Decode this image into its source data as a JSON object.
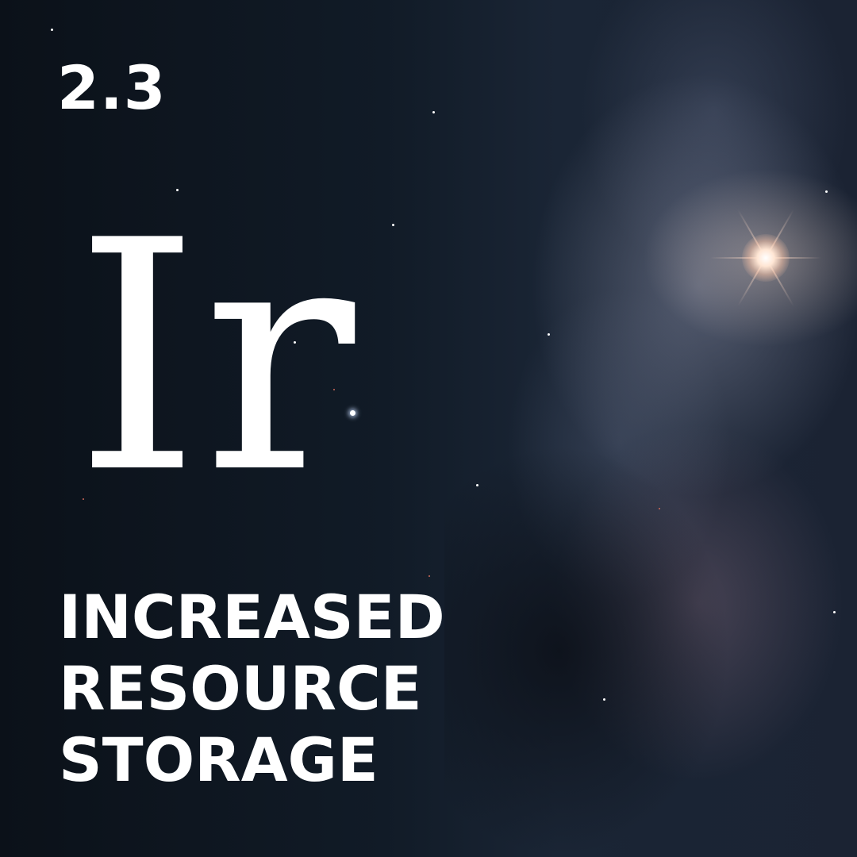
{
  "card": {
    "version": "2.3",
    "symbol": "Ir",
    "headline_lines": [
      "INCREASED",
      "RESOURCE",
      "STORAGE"
    ]
  },
  "colors": {
    "text": "#ffffff",
    "background": "#0e1620",
    "nebula": "#a0a5be",
    "star_glow": "#ffe6d4"
  }
}
